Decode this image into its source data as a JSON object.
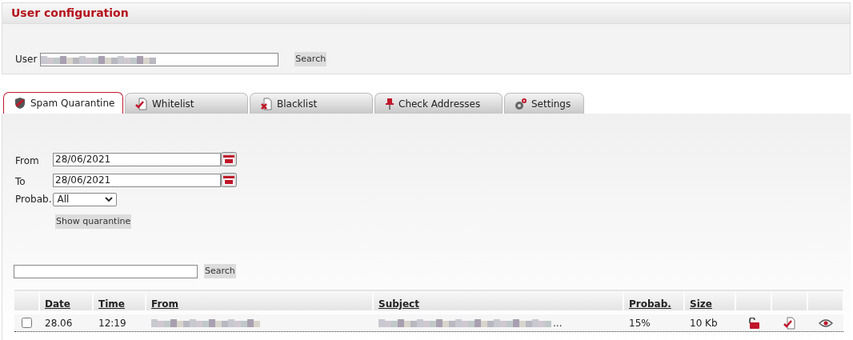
{
  "header": {
    "title": "User configuration"
  },
  "user_search": {
    "label": "User",
    "button": "Search"
  },
  "tabs": [
    {
      "label": "Spam Quarantine",
      "selected": true,
      "kind": "shield"
    },
    {
      "label": "Whitelist",
      "selected": false,
      "kind": "doc-check"
    },
    {
      "label": "Blacklist",
      "selected": false,
      "kind": "doc-cross"
    },
    {
      "label": "Check Addresses",
      "selected": false,
      "kind": "pin"
    },
    {
      "label": "Settings",
      "selected": false,
      "kind": "gears"
    }
  ],
  "filters": {
    "from_label": "From",
    "from_value": "28/06/2021",
    "to_label": "To",
    "to_value": "28/06/2021",
    "probab_label": "Probab.",
    "probab_value": "All",
    "show_button": "Show quarantine"
  },
  "search": {
    "button": "Search"
  },
  "table": {
    "columns": [
      "Date",
      "Time",
      "From",
      "Subject",
      "Probab.",
      "Size"
    ],
    "rows": [
      {
        "checked": false,
        "date": "28.06",
        "time": "12:19",
        "subject_tail": "...",
        "probab": "15%",
        "size": "10 Kb"
      }
    ]
  }
}
